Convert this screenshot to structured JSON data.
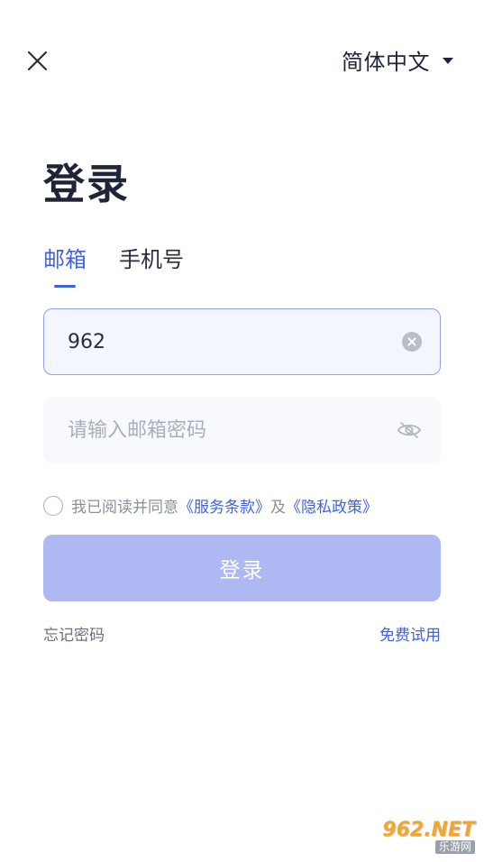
{
  "header": {
    "close_icon": "close-icon",
    "language": "简体中文"
  },
  "title": "登录",
  "tabs": [
    {
      "label": "邮箱",
      "active": true
    },
    {
      "label": "手机号",
      "active": false
    }
  ],
  "email_field": {
    "value": "962",
    "clear_icon": "clear-icon"
  },
  "password_field": {
    "placeholder": "请输入邮箱密码",
    "value": "",
    "visibility_icon": "eye-off-icon"
  },
  "agreement": {
    "prefix": "我已阅读并同意",
    "terms_link": "《服务条款》",
    "conjunction": "及",
    "privacy_link": "《隐私政策》",
    "checked": false
  },
  "login_button": "登录",
  "forgot_password": "忘记密码",
  "free_trial": "免费试用",
  "watermark": {
    "top": "962.NET",
    "bottom": "乐游网"
  },
  "colors": {
    "accent": "#3f63dd",
    "button_disabled": "#aeb9f4",
    "title": "#1f2438"
  }
}
